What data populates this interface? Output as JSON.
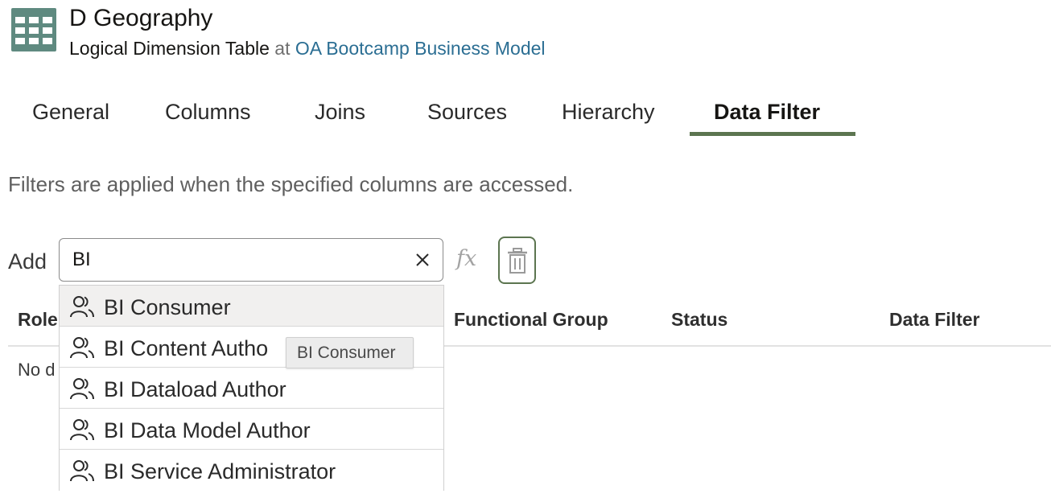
{
  "header": {
    "title": "D Geography",
    "object_type": "Logical Dimension Table",
    "at_word": "at",
    "model_link": "OA Bootcamp Business Model",
    "icon": "dimension-table-icon"
  },
  "tabs": [
    {
      "label": "General",
      "active": false
    },
    {
      "label": "Columns",
      "active": false
    },
    {
      "label": "Joins",
      "active": false
    },
    {
      "label": "Sources",
      "active": false
    },
    {
      "label": "Hierarchy",
      "active": false
    },
    {
      "label": "Data Filter",
      "active": true
    }
  ],
  "description": "Filters are applied when the specified columns are accessed.",
  "add_row": {
    "label": "Add",
    "search_value": "BI",
    "clear_icon": "close-icon",
    "fx_label": "fx",
    "delete_icon": "trash-icon"
  },
  "table": {
    "columns": [
      "Role",
      "Functional Group",
      "Status",
      "Data Filter"
    ],
    "empty_text": "No d"
  },
  "dropdown": {
    "options": [
      {
        "label": "BI Consumer",
        "icon": "users-icon",
        "highlighted": true
      },
      {
        "label": "BI Content Autho",
        "icon": "users-icon",
        "highlighted": false
      },
      {
        "label": "BI Dataload Author",
        "icon": "users-icon",
        "highlighted": false
      },
      {
        "label": "BI Data Model Author",
        "icon": "users-icon",
        "highlighted": false
      },
      {
        "label": "BI Service Administrator",
        "icon": "users-icon",
        "highlighted": false
      }
    ]
  },
  "tooltip": "BI Consumer",
  "colors": {
    "accent": "#5c7550",
    "link": "#2b6e93",
    "icon": "#5f8a80"
  }
}
